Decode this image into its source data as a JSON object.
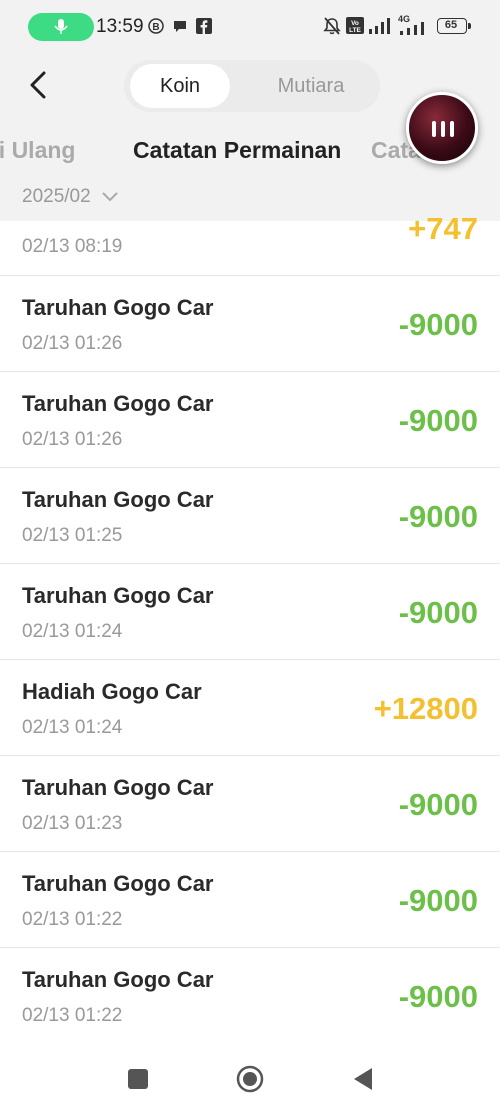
{
  "status_bar": {
    "time": "13:59",
    "battery": "65",
    "network": "4G"
  },
  "header": {
    "segments": [
      "Koin",
      "Mutiara"
    ],
    "tabs": [
      "si Ulang",
      "Catatan Permainan",
      "Cata"
    ],
    "date_filter": "2025/02"
  },
  "transactions": [
    {
      "title": "",
      "time": "02/13 08:19",
      "amount": "+747",
      "type": "pos"
    },
    {
      "title": "Taruhan Gogo Car",
      "time": "02/13 01:26",
      "amount": "-9000",
      "type": "neg"
    },
    {
      "title": "Taruhan Gogo Car",
      "time": "02/13 01:26",
      "amount": "-9000",
      "type": "neg"
    },
    {
      "title": "Taruhan Gogo Car",
      "time": "02/13 01:25",
      "amount": "-9000",
      "type": "neg"
    },
    {
      "title": "Taruhan Gogo Car",
      "time": "02/13 01:24",
      "amount": "-9000",
      "type": "neg"
    },
    {
      "title": "Hadiah Gogo Car",
      "time": "02/13 01:24",
      "amount": "+12800",
      "type": "pos"
    },
    {
      "title": "Taruhan Gogo Car",
      "time": "02/13 01:23",
      "amount": "-9000",
      "type": "neg"
    },
    {
      "title": "Taruhan Gogo Car",
      "time": "02/13 01:22",
      "amount": "-9000",
      "type": "neg"
    },
    {
      "title": "Taruhan Gogo Car",
      "time": "02/13 01:22",
      "amount": "-9000",
      "type": "neg"
    }
  ],
  "colors": {
    "negative": "#6cc04a",
    "positive": "#f4c030",
    "mic_pill": "#3ddc84"
  },
  "icons": {
    "back": "chevron-left-icon",
    "dropdown": "chevron-down-icon",
    "mic": "mic-icon",
    "floating": "pause-icon",
    "nav": [
      "recents-square-icon",
      "home-circle-icon",
      "back-triangle-icon"
    ]
  }
}
